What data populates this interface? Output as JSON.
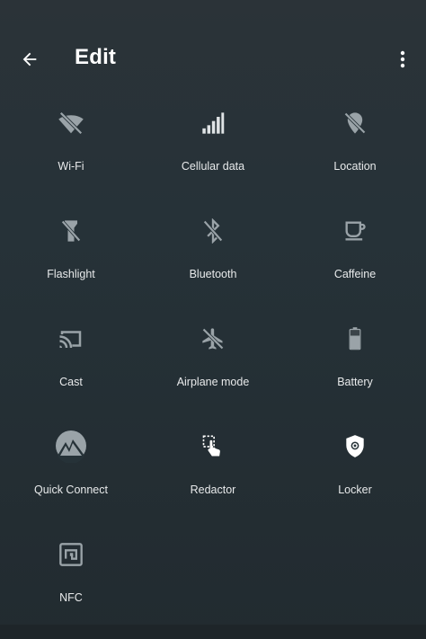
{
  "header": {
    "title": "Edit",
    "back_icon": "arrow-back-icon",
    "menu_icon": "more-vert-icon"
  },
  "colors": {
    "background": "#263238",
    "icon": "#9aa3a8",
    "text": "#e8eaeb"
  },
  "tiles": [
    {
      "label": "Wi-Fi",
      "icon": "wifi-off-icon"
    },
    {
      "label": "Cellular data",
      "icon": "signal-cellular-icon"
    },
    {
      "label": "Location",
      "icon": "location-off-icon"
    },
    {
      "label": "Flashlight",
      "icon": "flashlight-off-icon"
    },
    {
      "label": "Bluetooth",
      "icon": "bluetooth-off-icon"
    },
    {
      "label": "Caffeine",
      "icon": "coffee-cup-icon"
    },
    {
      "label": "Cast",
      "icon": "cast-icon"
    },
    {
      "label": "Airplane mode",
      "icon": "airplane-off-icon"
    },
    {
      "label": "Battery",
      "icon": "battery-icon"
    },
    {
      "label": "Quick Connect",
      "icon": "mountain-logo-icon"
    },
    {
      "label": "Redactor",
      "icon": "touch-select-icon"
    },
    {
      "label": "Locker",
      "icon": "shield-lock-icon"
    },
    {
      "label": "NFC",
      "icon": "nfc-icon"
    }
  ]
}
